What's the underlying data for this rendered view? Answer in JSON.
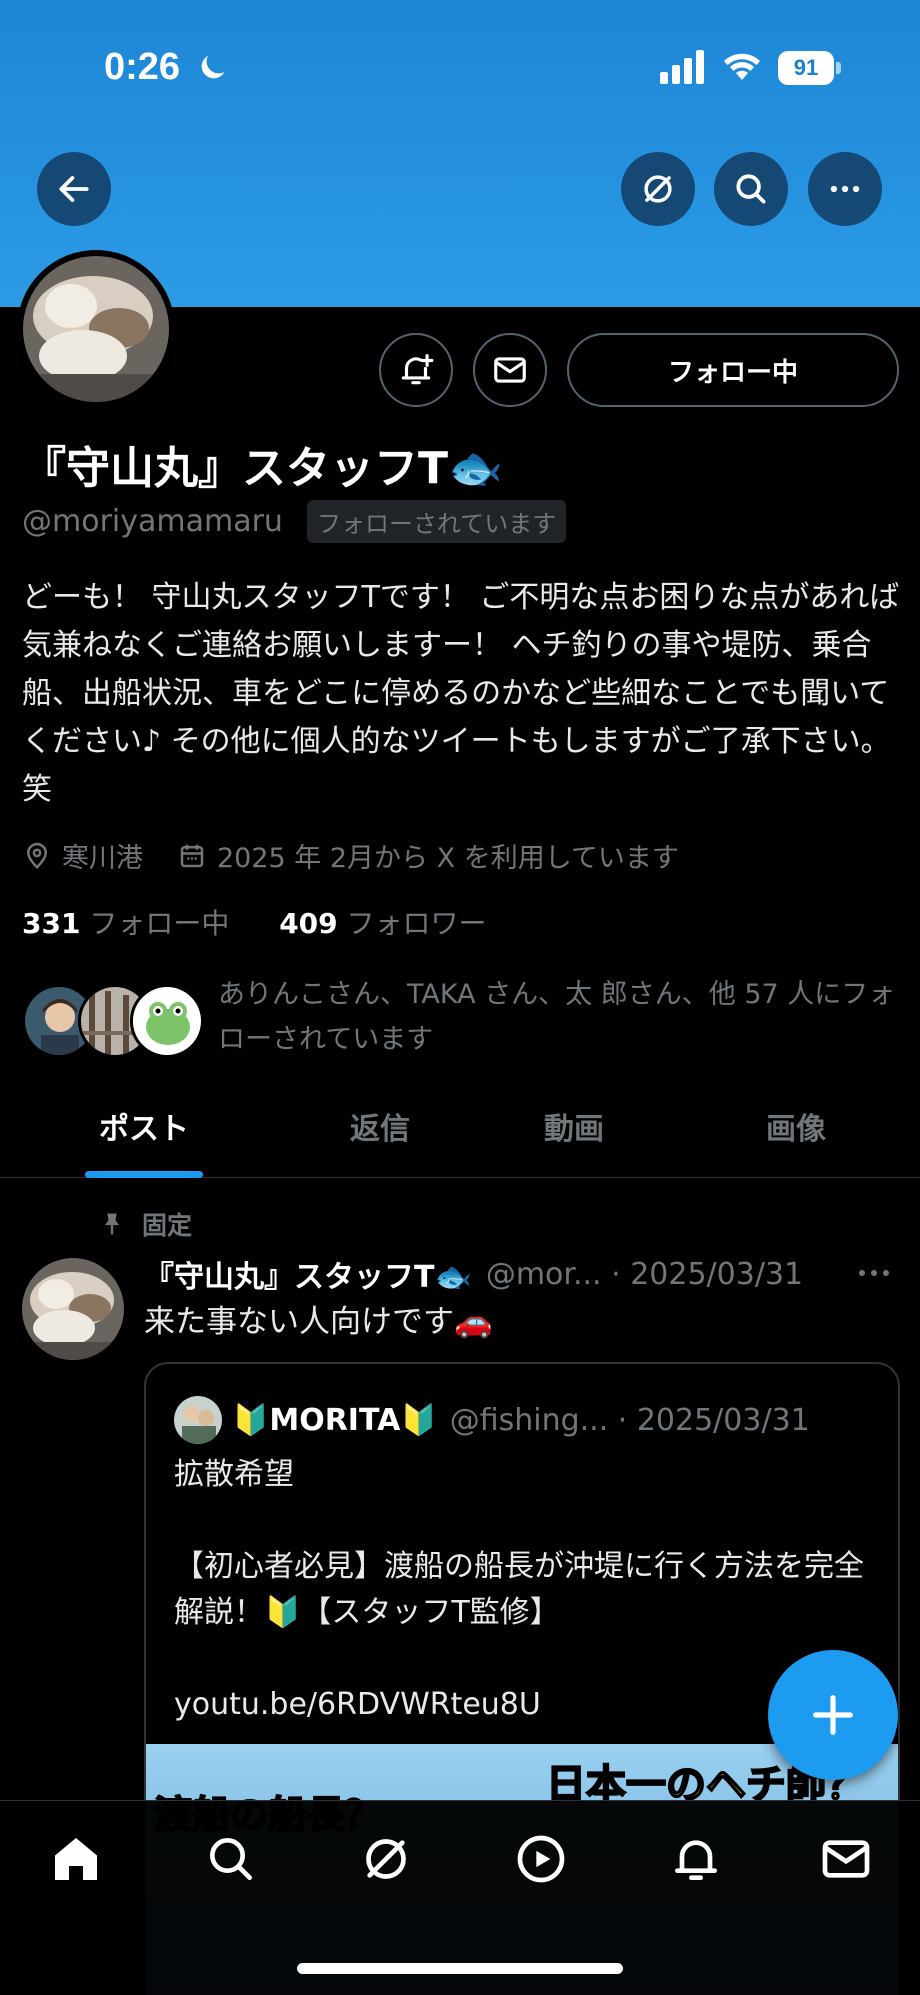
{
  "status_bar": {
    "time": "0:26",
    "battery": "91"
  },
  "colors": {
    "banner": "#2c9be6",
    "accent": "#1d9bf0",
    "background": "#000000"
  },
  "top_bar": {
    "back_icon": "arrow-left-icon",
    "grok_icon": "grok-icon",
    "search_icon": "search-icon",
    "more_icon": "more-icon"
  },
  "profile": {
    "name": "『守山丸』スタッフT🐟",
    "handle": "@moriyamamaru",
    "follows_you": "フォローされています",
    "follow_button": "フォロー中",
    "bio": "どーも！ 守山丸スタッフTです！ ご不明な点お困りな点があれば気兼ねなくご連絡お願いしますー！ ヘチ釣りの事や堤防、乗合船、出船状況、車をどこに停めるのかなど些細なことでも聞いてください♪ その他に個人的なツイートもしますがご了承下さい。笑",
    "location": "寒川港",
    "joined": "2025 年 2月から X を利用しています",
    "following_count": "331",
    "following_label": "フォロー中",
    "followers_count": "409",
    "followers_label": "フォロワー",
    "mutual_text": "ありんこさん、TAKA さん、太 郎さん、他 57 人にフォローされています"
  },
  "tabs": [
    {
      "label": "ポスト",
      "active": true
    },
    {
      "label": "返信",
      "active": false
    },
    {
      "label": "動画",
      "active": false
    },
    {
      "label": "画像",
      "active": false
    }
  ],
  "pinned_post": {
    "pinned_label": "固定",
    "author": "『守山丸』スタッフT🐟",
    "handle_date": "@mor... · 2025/03/31",
    "text": "来た事ない人向けです🚗",
    "quote": {
      "author": "🔰MORITA🔰",
      "handle_date": "@fishing... · 2025/03/31",
      "body": "拡散希望\n\n【初心者必見】渡船の船長が沖堤に行く方法を完全解説！🔰【スタッフT監修】\n\nyoutu.be/6RDVWRteu8U",
      "thumb_text_left": "渡船の船長？",
      "thumb_text_right": "日本一のヘチ師？"
    }
  },
  "bottom_nav": [
    "home-icon",
    "search-icon",
    "grok-icon",
    "play-icon",
    "bell-icon",
    "mail-icon"
  ]
}
